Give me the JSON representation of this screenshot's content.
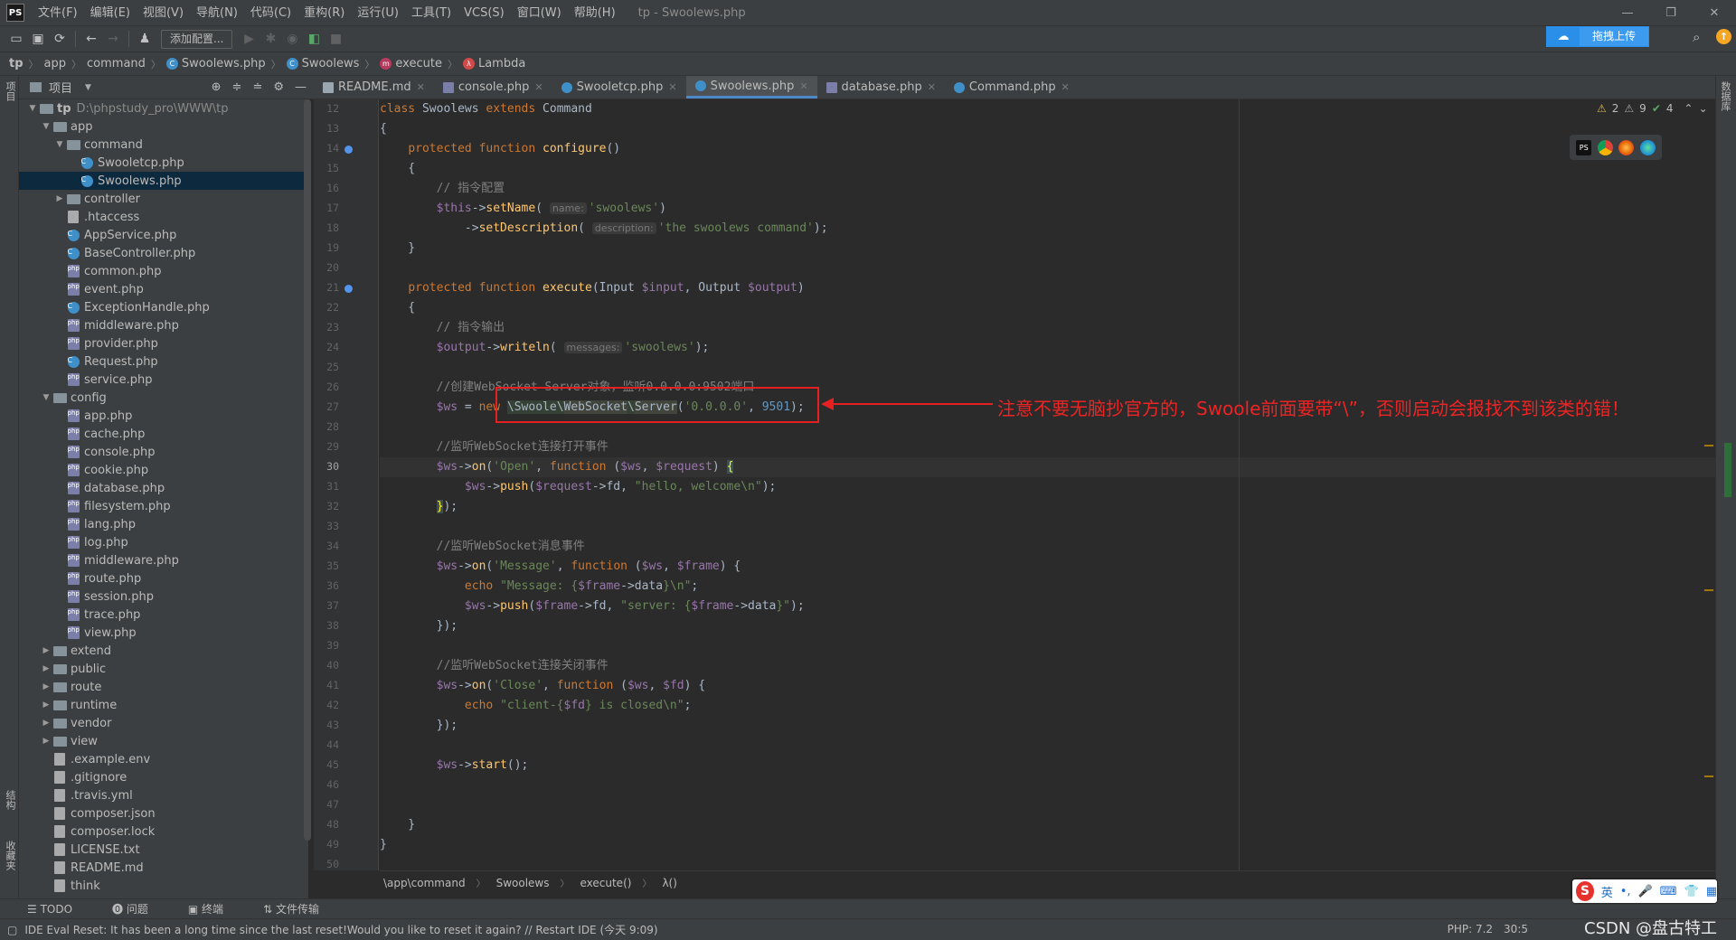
{
  "app": {
    "title": "tp - Swoolews.php",
    "logo": "PS",
    "menu": [
      "文件(F)",
      "编辑(E)",
      "视图(V)",
      "导航(N)",
      "代码(C)",
      "重构(R)",
      "运行(U)",
      "工具(T)",
      "VCS(S)",
      "窗口(W)",
      "帮助(H)"
    ]
  },
  "toolbar": {
    "add_config": "添加配置...",
    "upload_label": "拖拽上传"
  },
  "navbar": {
    "crumbs": [
      "tp",
      "app",
      "command",
      "Swoolews.php",
      "Swoolews",
      "execute",
      "Lambda"
    ]
  },
  "project_panel": {
    "title": "项目",
    "root": "tp",
    "root_path": "D:\\phpstudy_pro\\WWW\\tp",
    "items": [
      {
        "label": "app",
        "depth": 1,
        "type": "folder",
        "open": true
      },
      {
        "label": "command",
        "depth": 2,
        "type": "folder",
        "open": true
      },
      {
        "label": "Swooletcp.php",
        "depth": 3,
        "type": "class"
      },
      {
        "label": "Swoolews.php",
        "depth": 3,
        "type": "class",
        "selected": true
      },
      {
        "label": "controller",
        "depth": 2,
        "type": "folder",
        "open": false
      },
      {
        "label": ".htaccess",
        "depth": 2,
        "type": "file"
      },
      {
        "label": "AppService.php",
        "depth": 2,
        "type": "class"
      },
      {
        "label": "BaseController.php",
        "depth": 2,
        "type": "class"
      },
      {
        "label": "common.php",
        "depth": 2,
        "type": "php"
      },
      {
        "label": "event.php",
        "depth": 2,
        "type": "php"
      },
      {
        "label": "ExceptionHandle.php",
        "depth": 2,
        "type": "class"
      },
      {
        "label": "middleware.php",
        "depth": 2,
        "type": "php"
      },
      {
        "label": "provider.php",
        "depth": 2,
        "type": "php"
      },
      {
        "label": "Request.php",
        "depth": 2,
        "type": "class"
      },
      {
        "label": "service.php",
        "depth": 2,
        "type": "php"
      },
      {
        "label": "config",
        "depth": 1,
        "type": "folder",
        "open": true
      },
      {
        "label": "app.php",
        "depth": 2,
        "type": "php"
      },
      {
        "label": "cache.php",
        "depth": 2,
        "type": "php"
      },
      {
        "label": "console.php",
        "depth": 2,
        "type": "php"
      },
      {
        "label": "cookie.php",
        "depth": 2,
        "type": "php"
      },
      {
        "label": "database.php",
        "depth": 2,
        "type": "php"
      },
      {
        "label": "filesystem.php",
        "depth": 2,
        "type": "php"
      },
      {
        "label": "lang.php",
        "depth": 2,
        "type": "php"
      },
      {
        "label": "log.php",
        "depth": 2,
        "type": "php"
      },
      {
        "label": "middleware.php",
        "depth": 2,
        "type": "php"
      },
      {
        "label": "route.php",
        "depth": 2,
        "type": "php"
      },
      {
        "label": "session.php",
        "depth": 2,
        "type": "php"
      },
      {
        "label": "trace.php",
        "depth": 2,
        "type": "php"
      },
      {
        "label": "view.php",
        "depth": 2,
        "type": "php"
      },
      {
        "label": "extend",
        "depth": 1,
        "type": "folder",
        "open": false
      },
      {
        "label": "public",
        "depth": 1,
        "type": "folder",
        "open": false
      },
      {
        "label": "route",
        "depth": 1,
        "type": "folder",
        "open": false
      },
      {
        "label": "runtime",
        "depth": 1,
        "type": "folder",
        "open": false
      },
      {
        "label": "vendor",
        "depth": 1,
        "type": "folder",
        "open": false
      },
      {
        "label": "view",
        "depth": 1,
        "type": "folder",
        "open": false
      },
      {
        "label": ".example.env",
        "depth": 1,
        "type": "file"
      },
      {
        "label": ".gitignore",
        "depth": 1,
        "type": "file"
      },
      {
        "label": ".travis.yml",
        "depth": 1,
        "type": "file"
      },
      {
        "label": "composer.json",
        "depth": 1,
        "type": "file"
      },
      {
        "label": "composer.lock",
        "depth": 1,
        "type": "file"
      },
      {
        "label": "LICENSE.txt",
        "depth": 1,
        "type": "file"
      },
      {
        "label": "README.md",
        "depth": 1,
        "type": "file"
      },
      {
        "label": "think",
        "depth": 1,
        "type": "file"
      }
    ]
  },
  "tabs": [
    {
      "label": "README.md",
      "active": false
    },
    {
      "label": "console.php",
      "active": false
    },
    {
      "label": "Swooletcp.php",
      "active": false
    },
    {
      "label": "Swoolews.php",
      "active": true
    },
    {
      "label": "database.php",
      "active": false
    },
    {
      "label": "Command.php",
      "active": false
    }
  ],
  "editor": {
    "current_line": 30,
    "line_numbers": [
      12,
      13,
      14,
      15,
      16,
      17,
      18,
      19,
      20,
      21,
      22,
      23,
      24,
      25,
      26,
      27,
      28,
      29,
      30,
      31,
      32,
      33,
      34,
      35,
      36,
      37,
      38,
      39,
      40,
      41,
      42,
      43,
      44,
      45,
      46,
      47,
      48,
      49,
      50
    ],
    "inspections": {
      "warnings": "2",
      "weak": "9",
      "ok": "4"
    }
  },
  "annotation": {
    "text": "注意不要无脑抄官方的，Swoole前面要带“\\”，否则启动会报找不到该类的错！"
  },
  "bottom_breadcrumb": [
    "\\app\\command",
    "Swoolews",
    "execute()",
    "λ()"
  ],
  "tool_windows": [
    "TODO",
    "问题",
    "终端",
    "文件传输"
  ],
  "status": {
    "message": "IDE Eval Reset: It has been a long time since the last reset!Would you like to reset it again? // Restart IDE (今天 9:09)",
    "php": "PHP: 7.2",
    "pos": "30:5",
    "watermark": "CSDN @盘古特工"
  },
  "side_labels": {
    "left_top": "项目",
    "left_bottom1": "结构",
    "left_bottom2": "收藏夹",
    "right": "数据库"
  },
  "ime": {
    "lang": "英"
  },
  "colors": {
    "accent": "#4a88c7",
    "annotation": "#e52020",
    "keyword": "#cc7832",
    "string": "#6a8759",
    "function": "#ffc66d",
    "variable": "#9876aa",
    "comment": "#808080"
  }
}
